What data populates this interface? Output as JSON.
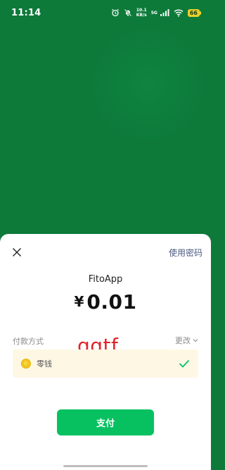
{
  "status_bar": {
    "time": "11:14",
    "net_speed_value": "10.1",
    "net_speed_unit": "KB/s",
    "signal_label": "5G",
    "battery_level": "66"
  },
  "sheet": {
    "close_icon": "close-icon",
    "use_password_label": "使用密码",
    "merchant_name": "FitoApp",
    "currency_symbol": "¥",
    "amount": "0.01",
    "payment_method_label": "付款方式",
    "change_label": "更改",
    "watermark_text": "qqtf",
    "selected_option": {
      "label": "零钱",
      "icon": "coin-icon",
      "selected": true
    },
    "pay_button_label": "支付"
  },
  "colors": {
    "background_green": "#0d7a3a",
    "pay_button_green": "#07c160",
    "battery_yellow": "#e8d02a",
    "link_color": "#4a5a80",
    "watermark_red": "#e0242a"
  }
}
